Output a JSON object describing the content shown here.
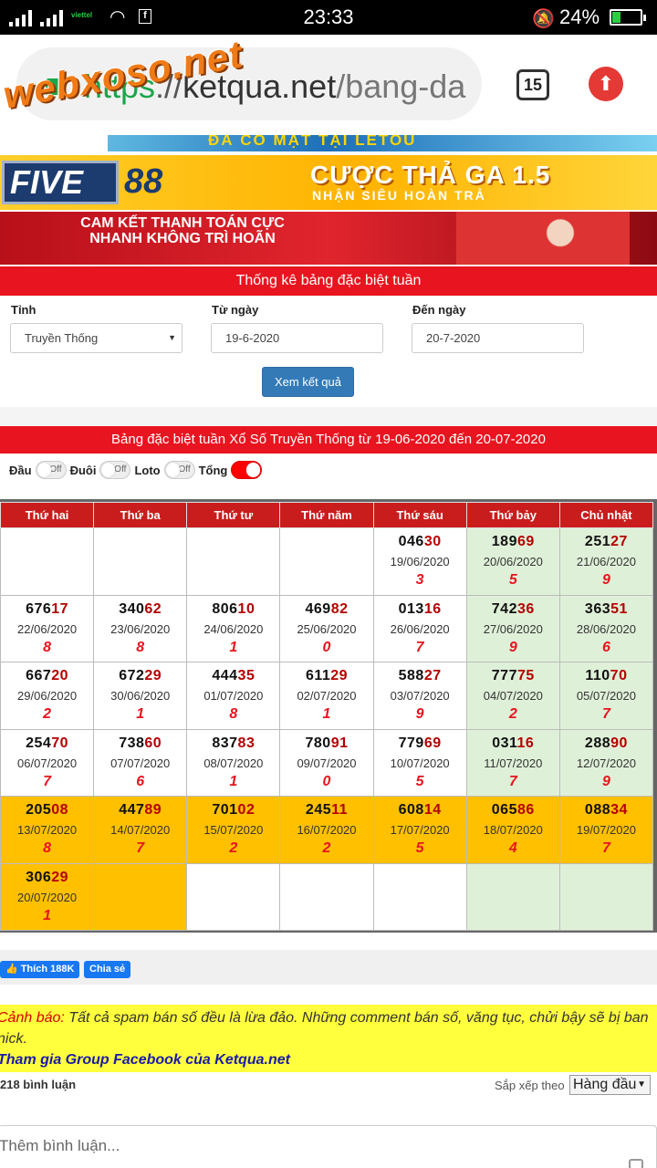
{
  "status": {
    "carrier": "viettel",
    "time": "23:33",
    "battery": "24%",
    "fb_icon": "f"
  },
  "browser": {
    "url_scheme": "https",
    "url_sep": "://",
    "url_host": "ketqua.net",
    "url_path": "/bang-da",
    "tab_count": "15",
    "watermark": "webxoso.net"
  },
  "banners": {
    "top_text": "ĐÃ CÓ MẶT TẠI LETOU",
    "five": "FIVE",
    "eightyeight": "88",
    "promo_title": "CƯỢC THẢ GA 1.5",
    "promo_sub": "NHẬN SIÊU HOÀN TRẢ",
    "commit_text": "CAM KẾT THANH TOÁN CỰC NHANH KHÔNG TRÌ HOÃN"
  },
  "form": {
    "heading": "Thống kê bảng đặc biệt tuần",
    "province_label": "Tỉnh",
    "province_value": "Truyền Thống",
    "from_label": "Từ ngày",
    "from_value": "19-6-2020",
    "to_label": "Đến ngày",
    "to_value": "20-7-2020",
    "submit": "Xem kết quả"
  },
  "table": {
    "heading": "Bảng đặc biệt tuần Xổ Số Truyền Thống từ 19-06-2020 đến 20-07-2020",
    "toggles": [
      {
        "label": "Đầu",
        "state": "Off"
      },
      {
        "label": "Đuôi",
        "state": "Off"
      },
      {
        "label": "Loto",
        "state": "Off"
      },
      {
        "label": "Tổng",
        "state": ""
      }
    ],
    "days": [
      "Thứ hai",
      "Thứ ba",
      "Thứ tư",
      "Thứ năm",
      "Thứ sáu",
      "Thứ bảy",
      "Chủ nhật"
    ],
    "rows": [
      [
        null,
        null,
        null,
        null,
        {
          "head": "046",
          "tail": "30",
          "date": "19/06/2020",
          "sum": "3"
        },
        {
          "head": "189",
          "tail": "69",
          "date": "20/06/2020",
          "sum": "5"
        },
        {
          "head": "251",
          "tail": "27",
          "date": "21/06/2020",
          "sum": "9"
        }
      ],
      [
        {
          "head": "676",
          "tail": "17",
          "date": "22/06/2020",
          "sum": "8"
        },
        {
          "head": "340",
          "tail": "62",
          "date": "23/06/2020",
          "sum": "8"
        },
        {
          "head": "806",
          "tail": "10",
          "date": "24/06/2020",
          "sum": "1"
        },
        {
          "head": "469",
          "tail": "82",
          "date": "25/06/2020",
          "sum": "0"
        },
        {
          "head": "013",
          "tail": "16",
          "date": "26/06/2020",
          "sum": "7"
        },
        {
          "head": "742",
          "tail": "36",
          "date": "27/06/2020",
          "sum": "9"
        },
        {
          "head": "363",
          "tail": "51",
          "date": "28/06/2020",
          "sum": "6"
        }
      ],
      [
        {
          "head": "667",
          "tail": "20",
          "date": "29/06/2020",
          "sum": "2"
        },
        {
          "head": "672",
          "tail": "29",
          "date": "30/06/2020",
          "sum": "1"
        },
        {
          "head": "444",
          "tail": "35",
          "date": "01/07/2020",
          "sum": "8"
        },
        {
          "head": "611",
          "tail": "29",
          "date": "02/07/2020",
          "sum": "1"
        },
        {
          "head": "588",
          "tail": "27",
          "date": "03/07/2020",
          "sum": "9"
        },
        {
          "head": "777",
          "tail": "75",
          "date": "04/07/2020",
          "sum": "2"
        },
        {
          "head": "110",
          "tail": "70",
          "date": "05/07/2020",
          "sum": "7"
        }
      ],
      [
        {
          "head": "254",
          "tail": "70",
          "date": "06/07/2020",
          "sum": "7"
        },
        {
          "head": "738",
          "tail": "60",
          "date": "07/07/2020",
          "sum": "6"
        },
        {
          "head": "837",
          "tail": "83",
          "date": "08/07/2020",
          "sum": "1"
        },
        {
          "head": "780",
          "tail": "91",
          "date": "09/07/2020",
          "sum": "0"
        },
        {
          "head": "779",
          "tail": "69",
          "date": "10/07/2020",
          "sum": "5"
        },
        {
          "head": "031",
          "tail": "16",
          "date": "11/07/2020",
          "sum": "7"
        },
        {
          "head": "288",
          "tail": "90",
          "date": "12/07/2020",
          "sum": "9"
        }
      ],
      [
        {
          "head": "205",
          "tail": "08",
          "date": "13/07/2020",
          "sum": "8"
        },
        {
          "head": "447",
          "tail": "89",
          "date": "14/07/2020",
          "sum": "7"
        },
        {
          "head": "701",
          "tail": "02",
          "date": "15/07/2020",
          "sum": "2"
        },
        {
          "head": "245",
          "tail": "11",
          "date": "16/07/2020",
          "sum": "2"
        },
        {
          "head": "608",
          "tail": "14",
          "date": "17/07/2020",
          "sum": "5"
        },
        {
          "head": "065",
          "tail": "86",
          "date": "18/07/2020",
          "sum": "4"
        },
        {
          "head": "088",
          "tail": "34",
          "date": "19/07/2020",
          "sum": "7"
        }
      ],
      [
        {
          "head": "306",
          "tail": "29",
          "date": "20/07/2020",
          "sum": "1"
        },
        null,
        null,
        null,
        null,
        null,
        null
      ]
    ]
  },
  "social": {
    "like": "Thích 188K",
    "share": "Chia sẻ"
  },
  "warning": {
    "label": "Cảnh báo:",
    "text": " Tất cả spam bán số đều là lừa đảo. Những comment bán số, văng tục, chửi bậy sẽ bị ban nick.",
    "group": "Tham gia Group Facebook của Ketqua.net"
  },
  "comments": {
    "count": "218 bình luận",
    "sort_label": "Sắp xếp theo",
    "sort_value": "Hàng đầu",
    "placeholder": "Thêm bình luận..."
  },
  "colors": {
    "red": "#e8141f",
    "header_red": "#c91d1d",
    "weekend_green": "#dff0d8",
    "current_week": "#ffc000",
    "primary_button": "#337ab7"
  }
}
